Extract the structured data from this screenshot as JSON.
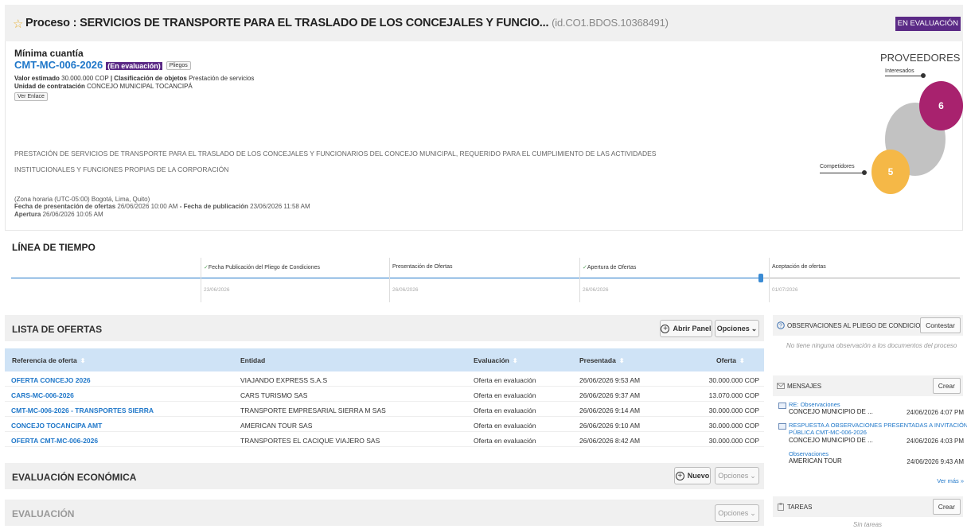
{
  "header": {
    "title": "Proceso : SERVICIOS DE TRANSPORTE PARA EL TRASLADO DE LOS CONCEJALES Y FUNCIO...",
    "process_id": "(id.CO1.BDOS.10368491)",
    "status_badge": "EN EVALUACIÓN"
  },
  "summary": {
    "modality": "Mínima cuantía",
    "code": "CMT-MC-006-2026",
    "status_tag": "(En evaluación)",
    "pliegos_button": "Pliegos",
    "valor_label": "Valor estimado",
    "valor": "30.000.000 COP",
    "clasificacion_label": "| Clasificación de objetos",
    "clasificacion": "Prestación de servicios",
    "unidad_label": "Unidad de contratación",
    "unidad": "CONCEJO MUNICIPAL TOCANCIPÁ",
    "ver_enlace_button": "Ver Enlace",
    "description": "PRESTACIÓN DE SERVICIOS DE TRANSPORTE PARA EL TRASLADO DE LOS CONCEJALES Y FUNCIONARIOS DEL CONCEJO MUNICIPAL, REQUERIDO PARA EL CUMPLIMIENTO DE LAS ACTIVIDADES INSTITUCIONALES Y FUNCIONES PROPIAS DE LA CORPORACIÓN",
    "timezone": "(Zona horaria (UTC-05:00) Bogotá, Lima, Quito)",
    "fecha_presentacion_label": "Fecha de presentación de ofertas",
    "fecha_presentacion": "26/06/2026 10:00 AM",
    "fecha_publicacion_label": "- Fecha de publicación",
    "fecha_publicacion": "23/06/2026 11:58 AM",
    "apertura_label": "Apertura",
    "apertura": "26/06/2026 10:05 AM"
  },
  "proveedores": {
    "title": "PROVEEDORES",
    "interesados_label": "Interesados",
    "interesados_count": "6",
    "competidores_label": "Competidores",
    "competidores_count": "5",
    "color_interesados": "#a8226e",
    "color_competidores": "#f5b847",
    "color_total": "#c2c2c2"
  },
  "timeline": {
    "title": "LÍNEA DE TIEMPO",
    "progress_fraction": 0.79,
    "milestones": [
      {
        "label": "Fecha Publicación del Pliego de Condiciones",
        "date": "23/06/2026",
        "check": "✓"
      },
      {
        "label": "Presentación de Ofertas",
        "date": "26/06/2026",
        "check": ""
      },
      {
        "label": "Apertura de Ofertas",
        "date": "26/06/2026",
        "check": "✓"
      },
      {
        "label": "Aceptación de ofertas",
        "date": "01/07/2026",
        "check": ""
      }
    ]
  },
  "ofertas": {
    "title": "LISTA DE OFERTAS",
    "abrir_panel_button": "Abrir Panel",
    "opciones_button": "Opciones",
    "columns": [
      "Referencia de oferta",
      "Entidad",
      "Evaluación",
      "Presentada",
      "Oferta"
    ],
    "rows": [
      {
        "ref": "OFERTA CONCEJO 2026",
        "entidad": "VIAJANDO EXPRESS S.A.S",
        "evaluacion": "Oferta en evaluación",
        "presentada": "26/06/2026 9:53 AM",
        "oferta": "30.000.000 COP"
      },
      {
        "ref": "CARS-MC-006-2026",
        "entidad": "CARS TURISMO SAS",
        "evaluacion": "Oferta en evaluación",
        "presentada": "26/06/2026 9:37 AM",
        "oferta": "13.070.000 COP"
      },
      {
        "ref": "CMT-MC-006-2026 - TRANSPORTES SIERRA",
        "entidad": "TRANSPORTE EMPRESARIAL SIERRA M SAS",
        "evaluacion": "Oferta en evaluación",
        "presentada": "26/06/2026 9:14 AM",
        "oferta": "30.000.000 COP"
      },
      {
        "ref": "CONCEJO TOCANCIPA AMT",
        "entidad": "AMERICAN TOUR SAS",
        "evaluacion": "Oferta en evaluación",
        "presentada": "26/06/2026 9:10 AM",
        "oferta": "30.000.000 COP"
      },
      {
        "ref": "OFERTA CMT-MC-006-2026",
        "entidad": "TRANSPORTES EL CACIQUE VIAJERO SAS",
        "evaluacion": "Oferta en evaluación",
        "presentada": "26/06/2026 8:42 AM",
        "oferta": "30.000.000 COP"
      }
    ]
  },
  "evaluacion_economica": {
    "title": "EVALUACIÓN ECONÓMICA",
    "nuevo_button": "Nuevo",
    "opciones_button": "Opciones"
  },
  "evaluacion": {
    "title": "EVALUACIÓN",
    "opciones_button": "Opciones"
  },
  "observaciones": {
    "title": "OBSERVACIONES AL PLIEGO DE CONDICIONES",
    "contestar_button": "Contestar",
    "empty": "No tiene ninguna observación a los documentos del proceso"
  },
  "mensajes": {
    "title": "MENSAJES",
    "crear_button": "Crear",
    "items": [
      {
        "subject": "RE: Observaciones",
        "subject2": "",
        "from": "CONCEJO MUNICIPIO DE ...",
        "date": "24/06/2026 4:07 PM"
      },
      {
        "subject": "RESPUESTA A OBSERVACIONES PRESENTADAS A INVITACIÓN",
        "subject2": "PÚBLICA CMT-MC-006-2026",
        "from": "CONCEJO MUNICIPIO DE ...",
        "date": "24/06/2026 4:03 PM"
      },
      {
        "subject": "Observaciones",
        "subject2": "",
        "from": "AMERICAN TOUR",
        "date": "24/06/2026 9:43 AM"
      }
    ],
    "ver_mas": "Ver más »"
  },
  "tareas": {
    "title": "TAREAS",
    "crear_button": "Crear",
    "empty": "Sin tareas"
  }
}
